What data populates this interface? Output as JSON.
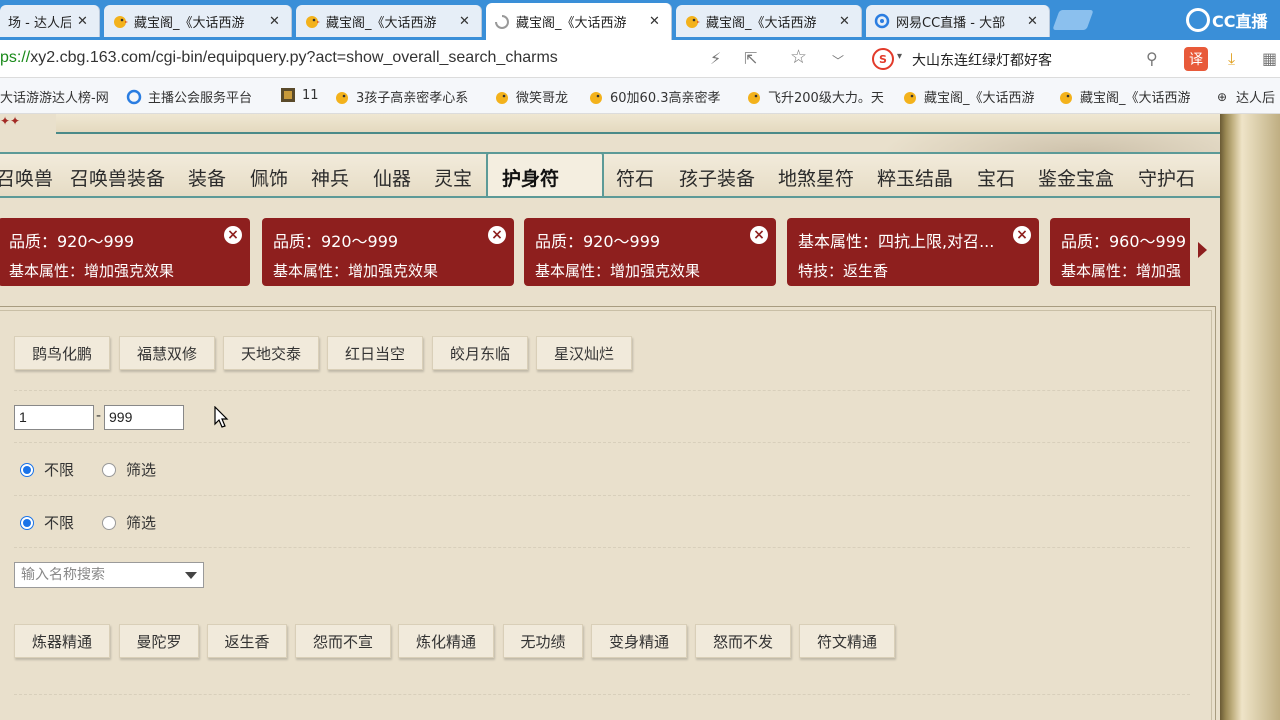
{
  "browser": {
    "tabs": [
      {
        "title": "场 - 达人后",
        "icon": "page-icon",
        "active": false
      },
      {
        "title": "藏宝阁_《大话西游",
        "icon": "cbg-chick-icon",
        "active": false
      },
      {
        "title": "藏宝阁_《大话西游",
        "icon": "cbg-chick-icon",
        "active": false
      },
      {
        "title": "藏宝阁_《大话西游",
        "icon": "loading-icon",
        "active": true
      },
      {
        "title": "藏宝阁_《大话西游",
        "icon": "cbg-chick-icon",
        "active": false
      },
      {
        "title": "网易CC直播 - 大部",
        "icon": "cc-icon",
        "active": false
      }
    ],
    "cc_logo_text": "CC直播",
    "url_scheme": "ps://",
    "url_rest": "xy2.cbg.163.com/cgi-bin/equipquery.py?act=show_overall_search_charms",
    "search_box_text": "大山东连红绿灯都好客",
    "translate_label": "译",
    "bookmarks": [
      {
        "label": "大话游游达人榜-网",
        "icon": "page-icon"
      },
      {
        "label": "主播公会服务平台",
        "icon": "cc-icon"
      },
      {
        "label": "11",
        "icon": "game-icon"
      },
      {
        "label": "3孩子高亲密孝心系",
        "icon": "cbg-chick-icon"
      },
      {
        "label": "微笑哥龙",
        "icon": "cbg-chick-icon"
      },
      {
        "label": "60加60.3高亲密孝",
        "icon": "cbg-chick-icon"
      },
      {
        "label": "飞升200级大力。天",
        "icon": "cbg-chick-icon"
      },
      {
        "label": "藏宝阁_《大话西游",
        "icon": "cbg-chick-icon"
      },
      {
        "label": "藏宝阁_《大话西游",
        "icon": "cbg-chick-icon"
      },
      {
        "label": "达人后",
        "icon": "globe-icon"
      }
    ]
  },
  "categories": [
    "召唤兽",
    "召唤兽装备",
    "装备",
    "佩饰",
    "神兵",
    "仙器",
    "灵宝",
    "护身符",
    "符石",
    "孩子装备",
    "地煞星符",
    "粹玉结晶",
    "宝石",
    "鉴金宝盒",
    "守护石"
  ],
  "active_category": "护身符",
  "filter_chips": [
    {
      "line1": "品质：920～999",
      "line2": "基本属性：增加强克效果"
    },
    {
      "line1": "品质：920～999",
      "line2": "基本属性：增加强克效果"
    },
    {
      "line1": "品质：920～999",
      "line2": "基本属性：增加强克效果"
    },
    {
      "line1": "基本属性：四抗上限,对召...",
      "line2": "特技：返生香"
    },
    {
      "line1": "品质：960～999",
      "line2": "基本属性：增加强"
    }
  ],
  "charm_types": [
    "鹍鸟化鹏",
    "福慧双修",
    "天地交泰",
    "红日当空",
    "皎月东临",
    "星汉灿烂"
  ],
  "range": {
    "min": "1",
    "max": "999",
    "separator": "-"
  },
  "radio_group_1": {
    "options": [
      "不限",
      "筛选"
    ],
    "selected": 0
  },
  "radio_group_2": {
    "options": [
      "不限",
      "筛选"
    ],
    "selected": 0
  },
  "name_search": {
    "placeholder": "输入名称搜索"
  },
  "skills": [
    "炼器精通",
    "曼陀罗",
    "返生香",
    "怨而不宣",
    "炼化精通",
    "无功绩",
    "变身精通",
    "怒而不发",
    "符文精通"
  ],
  "colors": {
    "chip_bg": "#8e1f1e",
    "tab_bar": "#3a8fd8",
    "accent_teal": "#5c9a97"
  }
}
